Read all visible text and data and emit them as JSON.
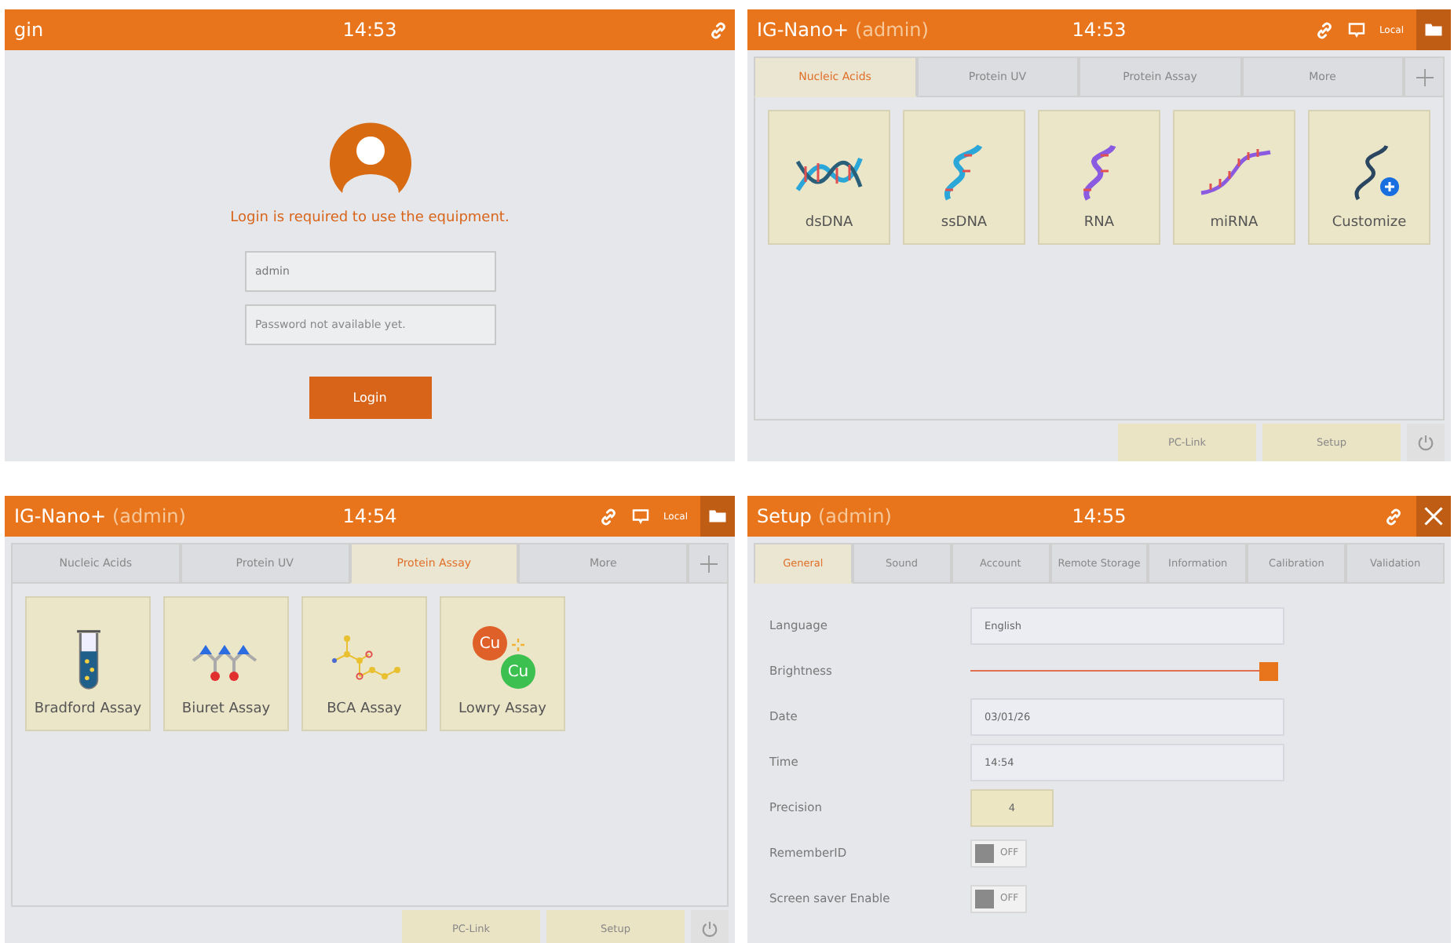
{
  "panels": [
    {
      "kind": "login",
      "title": "gin",
      "time": "14:53",
      "message": "Login is required to use the equipment.",
      "username": {
        "value": "admin"
      },
      "password": {
        "placeholder": "Password not available yet."
      },
      "button": "Login"
    },
    {
      "kind": "menu",
      "title": "IG-Nano+",
      "user": "(admin)",
      "time": "14:53",
      "status": "Local",
      "tabs": [
        {
          "label": "Nucleic Acids",
          "selected": true
        },
        {
          "label": "Protein UV",
          "selected": false
        },
        {
          "label": "Protein Assay",
          "selected": false
        },
        {
          "label": "More",
          "selected": false
        }
      ],
      "tiles": [
        {
          "label": "dsDNA",
          "kind": "double-helix"
        },
        {
          "label": "ssDNA",
          "kind": "single-strand"
        },
        {
          "label": "RNA",
          "kind": "rna-strand"
        },
        {
          "label": "miRNA",
          "kind": "short-strand"
        },
        {
          "label": "Customize",
          "kind": "customize"
        }
      ],
      "footer_buttons": [
        "PC-Link",
        "Setup"
      ]
    },
    {
      "kind": "menu",
      "title": "IG-Nano+",
      "user": "(admin)",
      "time": "14:54",
      "status": "Local",
      "tabs": [
        {
          "label": "Nucleic Acids",
          "selected": false
        },
        {
          "label": "Protein UV",
          "selected": false
        },
        {
          "label": "Protein Assay",
          "selected": true
        },
        {
          "label": "More",
          "selected": false
        }
      ],
      "tiles": [
        {
          "label": "Bradford Assay",
          "kind": "test-tube"
        },
        {
          "label": "Biuret Assay",
          "kind": "ball-stick"
        },
        {
          "label": "BCA Assay",
          "kind": "dot-chain"
        },
        {
          "label": "Lowry Assay",
          "kind": "copper",
          "icon_texts": [
            "Cu",
            "Cu"
          ]
        }
      ],
      "footer_buttons": [
        "PC-Link",
        "Setup"
      ]
    },
    {
      "kind": "setup",
      "title": "Setup",
      "user": "(admin)",
      "time": "14:55",
      "tabs": [
        {
          "label": "General",
          "selected": true
        },
        {
          "label": "Sound",
          "selected": false
        },
        {
          "label": "Account",
          "selected": false
        },
        {
          "label": "Remote Storage",
          "selected": false
        },
        {
          "label": "Information",
          "selected": false
        },
        {
          "label": "Calibration",
          "selected": false
        },
        {
          "label": "Validation",
          "selected": false
        }
      ],
      "rows": [
        {
          "kind": "field",
          "label": "Language",
          "value": "English"
        },
        {
          "kind": "slider",
          "label": "Brightness",
          "level": 1
        },
        {
          "kind": "field",
          "label": "Date",
          "value": "03/01/26"
        },
        {
          "kind": "field",
          "label": "Time",
          "value": "14:54"
        },
        {
          "kind": "number",
          "label": "Precision",
          "value": "4"
        },
        {
          "kind": "toggle",
          "label": "RememberID",
          "on": false,
          "state_text": "OFF"
        },
        {
          "kind": "toggle",
          "label": "Screen saver Enable",
          "on": false,
          "state_text": "OFF"
        }
      ]
    }
  ]
}
